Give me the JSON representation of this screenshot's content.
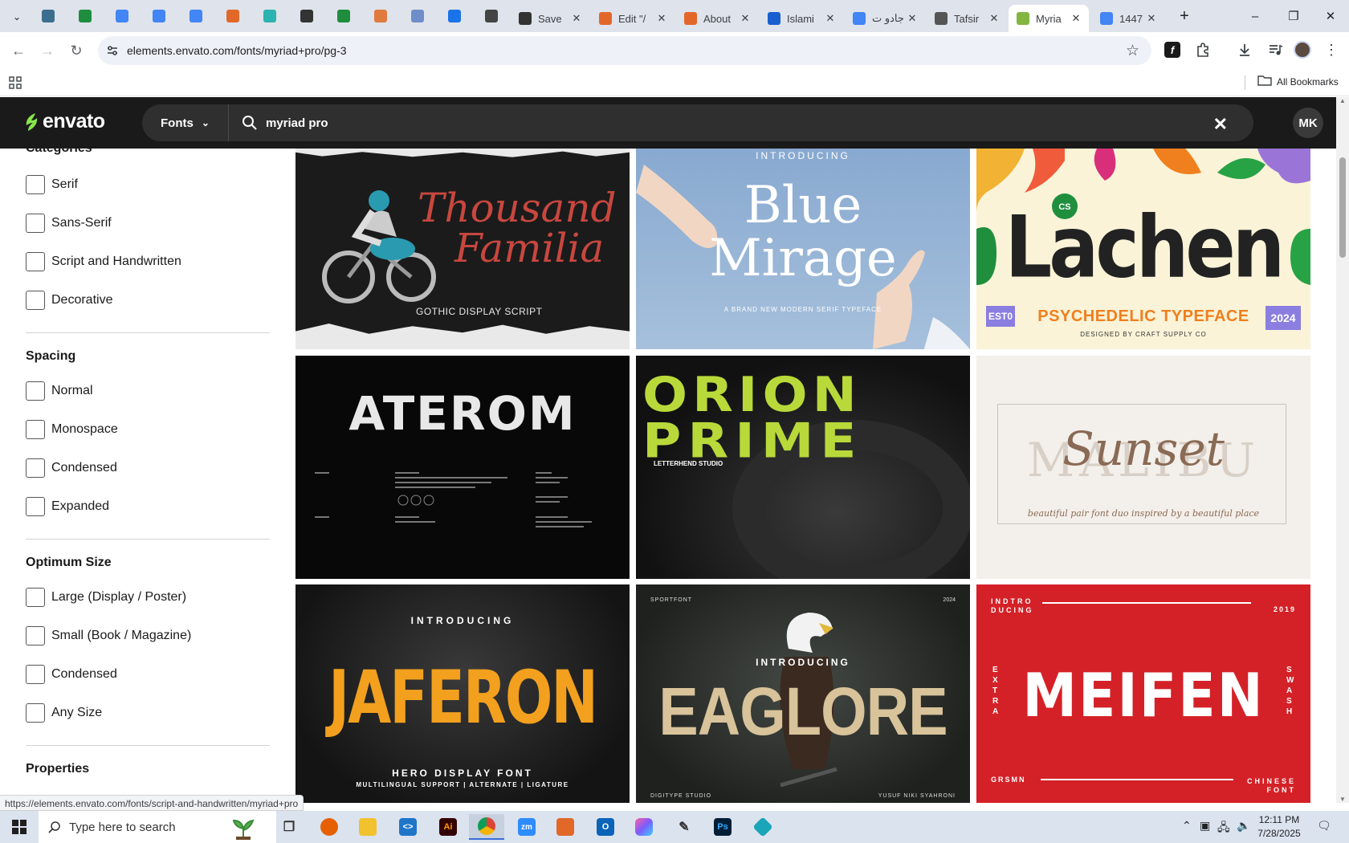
{
  "tabs": {
    "pinned": [
      {
        "icon": "wordpress-icon",
        "color": "#3c6e8f"
      },
      {
        "icon": "sheets-icon",
        "color": "#1e8e3e"
      },
      {
        "icon": "docs-icon",
        "color": "#4285f4"
      },
      {
        "icon": "docs-icon",
        "color": "#4285f4"
      },
      {
        "icon": "docs-icon",
        "color": "#4285f4"
      },
      {
        "icon": "envato-market-icon",
        "color": "#e2682a"
      },
      {
        "icon": "app-icon",
        "color": "#2bb3b1"
      },
      {
        "icon": "chatgpt-icon",
        "color": "#333333"
      },
      {
        "icon": "sheets-icon",
        "color": "#1e8e3e"
      },
      {
        "icon": "hand-icon",
        "color": "#e07a3d"
      },
      {
        "icon": "grid-app-icon",
        "color": "#6f8ec9"
      },
      {
        "icon": "forms-icon",
        "color": "#1a73e8"
      },
      {
        "icon": "speaker-icon",
        "color": "#444444"
      }
    ],
    "items": [
      {
        "title": "Save",
        "icon": "chatgpt-icon",
        "color": "#333333"
      },
      {
        "title": "Edit \"/",
        "icon": "envato-market-icon",
        "color": "#e2682a"
      },
      {
        "title": "About",
        "icon": "envato-market-icon",
        "color": "#e2682a"
      },
      {
        "title": "Islami",
        "icon": "docs-icon",
        "color": "#1a5fd0"
      },
      {
        "title": "جادو ت",
        "icon": "google-icon",
        "color": "#4285f4"
      },
      {
        "title": "Tafsir",
        "icon": "book-icon",
        "color": "#555555"
      },
      {
        "title": "Myria",
        "icon": "envato-icon",
        "color": "#82b541",
        "active": true
      },
      {
        "title": "1447",
        "icon": "google-icon",
        "color": "#4285f4"
      }
    ],
    "new_tab": "+"
  },
  "window_controls": {
    "minimize": "–",
    "restore": "❐",
    "close": "✕"
  },
  "toolbar": {
    "url": "elements.envato.com/fonts/myriad+pro/pg-3"
  },
  "bookmarks": {
    "all_bookmarks": "All Bookmarks"
  },
  "envato": {
    "logo": "envato",
    "category_dropdown": "Fonts",
    "search_query": "myriad pro",
    "avatar_initials": "MK"
  },
  "sidebar": {
    "categories": {
      "title": "Categories",
      "options": [
        "Serif",
        "Sans-Serif",
        "Script and Handwritten",
        "Decorative"
      ]
    },
    "spacing": {
      "title": "Spacing",
      "options": [
        "Normal",
        "Monospace",
        "Condensed",
        "Expanded"
      ]
    },
    "optimum_size": {
      "title": "Optimum Size",
      "options": [
        "Large (Display / Poster)",
        "Small (Book / Magazine)",
        "Condensed",
        "Any Size"
      ]
    },
    "properties": {
      "title": "Properties"
    }
  },
  "cards": [
    {
      "name": "Thousand Familia",
      "line1": "Thousand",
      "line2": "Familia",
      "sub": "GOTHIC DISPLAY SCRIPT",
      "bg": "#1b1b1b",
      "color": "#c7473f"
    },
    {
      "name": "Blue Mirage",
      "top": "INTRODUCING",
      "line1": "Blue",
      "line2": "Mirage",
      "sub": "A BRAND NEW MODERN SERIF TYPEFACE",
      "bg": "#8fb0d4",
      "color": "#ffffff"
    },
    {
      "name": "Lachen",
      "line1": "Lachen",
      "sub": "PSYCHEDELIC TYPEFACE",
      "foot": "DESIGNED BY CRAFT SUPPLY CO",
      "left_tag": "EST0",
      "right_tag": "2024",
      "bg": "#faf3d7",
      "color": "#222222"
    },
    {
      "name": "Aterom",
      "line1": "ATEROM",
      "bg": "#080808",
      "color": "#e8e8e8"
    },
    {
      "name": "Orion Prime",
      "line1": "ORION",
      "line2": "PRIME",
      "sub": "LETTERHEND STUDIO",
      "bg": "#1c1c1c",
      "color": "#b9d93a"
    },
    {
      "name": "Sunset Malibu",
      "line1": "Sunset",
      "line2": "MALIBU",
      "sub": "beautiful pair font duo inspired by a beautiful place",
      "bg": "#f3efea",
      "color": "#8a6a55"
    },
    {
      "name": "Jaferon",
      "top": "INTRODUCING",
      "line1": "JAFERON",
      "sub": "HERO DISPLAY FONT",
      "foot": "MULTILINGUAL SUPPORT | ALTERNATE | LIGATURE",
      "bg": "#1a1a1a",
      "color": "#f2a01e"
    },
    {
      "name": "Eaglore",
      "corner_left": "SPORTFONT",
      "corner_right": "2024",
      "top": "INTRODUCING",
      "line1": "EAGLORE",
      "foot_left": "DIGITYPE STUDIO",
      "foot_right": "YUSUF NIKI SYAHRONI",
      "bg": "#2a2d2a",
      "color": "#d8c39a"
    },
    {
      "name": "Meifen",
      "top": "INDTRO DUCING",
      "year": "2019",
      "line1": "MEIFEN",
      "left_side": "EXTRA",
      "right_side": "SWASH",
      "foot_left": "GRSMN",
      "foot_right": "CHINESE FONT",
      "bg": "#d42127",
      "color": "#ffffff"
    }
  ],
  "status_url": "https://elements.envato.com/fonts/script-and-handwritten/myriad+pro",
  "taskbar": {
    "search_placeholder": "Type here to search",
    "time": "12:11 PM",
    "date": "7/28/2025"
  }
}
